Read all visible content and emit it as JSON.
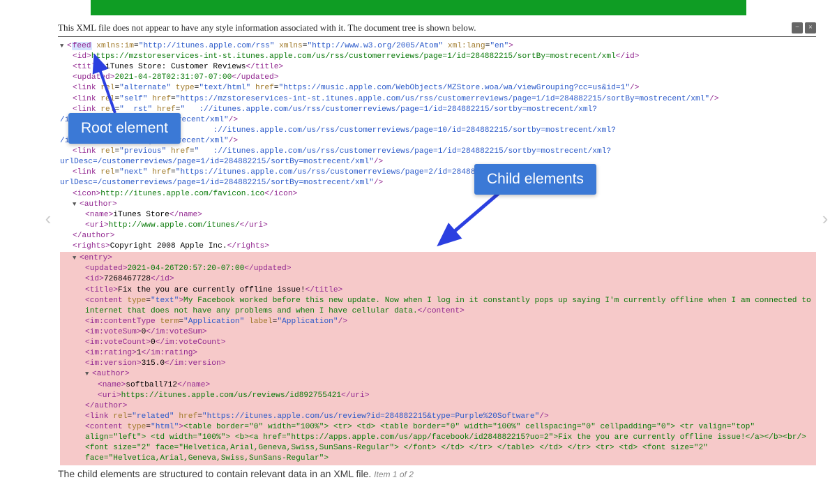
{
  "ui": {
    "info_text": "This XML file does not appear to have any style information associated with it. The document tree is shown below.",
    "minus_icon": "−",
    "close_icon": "×"
  },
  "callouts": {
    "root": "Root element",
    "child": "Child elements"
  },
  "caption": {
    "text": "The child elements are structured to contain relevant data in an XML file.",
    "item": "Item 1 of 2"
  },
  "xml": {
    "feed_open": {
      "tag": "feed",
      "attrs": "xmlns:im=\"http://itunes.apple.com/rss\" xmlns=\"http://www.w3.org/2005/Atom\" xml:lang=\"en\""
    },
    "id_url": "https://mzstoreservices-int-st.itunes.apple.com/us/rss/customerreviews/page=1/id=284882215/sortBy=mostrecent/xml",
    "title": "iTunes Store: Customer Reviews",
    "updated": "2021-04-28T02:31:07-07:00",
    "link_alt": {
      "rel": "alternate",
      "type": "text/html",
      "href": "https://music.apple.com/WebObjects/MZStore.woa/wa/viewGrouping?cc=us&id=1"
    },
    "link_self": {
      "rel": "self",
      "href": "https://mzstoreservices-int-st.itunes.apple.com/us/rss/customerreviews/page=1/id=284882215/sortBy=mostrecent/xml"
    },
    "link_first": {
      "rel": "first",
      "href_a": "://itunes.apple.com/us/rss/customerreviews/page=1/id=284882215/sortby=mostrecent/xml?",
      "href_b": "/id=284882215/sortBy=mostrecent/xml"
    },
    "link_last": {
      "href_a": "://itunes.apple.com/us/rss/customerreviews/page=10/id=284882215/sortby=mostrecent/xml?",
      "href_b": "/id=284882215/sortBy=mostrecent/xml"
    },
    "link_prev": {
      "rel": "previous",
      "href_line": "://itunes.apple.com/us/rss/customerreviews/page=1/id=284882215/sortby=mostrecent/xml?",
      "cont": "urlDesc=/customerreviews/page=1/id=284882215/sortBy=mostrecent/xml"
    },
    "link_next": {
      "rel": "next",
      "href_line": "https://itunes.apple.com/us/rss/customerreviews/page=2/id=284882215/sortby=m",
      "cont": "urlDesc=/customerreviews/page=1/id=284882215/sortBy=mostrecent/xml"
    },
    "icon": "http://itunes.apple.com/favicon.ico",
    "author_name": "iTunes Store",
    "author_uri": "http://www.apple.com/itunes/",
    "rights": "Copyright 2008 Apple Inc.",
    "entry": {
      "updated": "2021-04-26T20:57:20-07:00",
      "id": "7268467728",
      "title": "Fix the you are currently offline issue!",
      "content_text": "My Facebook worked before this new update. Now when I log in it constantly pops up saying I'm currently offline when I am connected to internet that does not have any problems and when I have cellular data.",
      "contentType": {
        "term": "Application",
        "label": "Application"
      },
      "voteSum": "0",
      "voteCount": "0",
      "rating": "1",
      "version": "315.0",
      "author_name": "softball712",
      "author_uri": "https://itunes.apple.com/us/reviews/id892755421",
      "link_related": "https://itunes.apple.com/us/review?id=284882215&type=Purple%20Software",
      "html_content": "<table border=\"0\" width=\"100%\"> <tr> <td> <table border=\"0\" width=\"100%\" cellspacing=\"0\" cellpadding=\"0\"> <tr valign=\"top\" align=\"left\"> <td width=\"100%\"> <b><a href=\"https://apps.apple.com/us/app/facebook/id284882215?uo=2\">Fix the you are currently offline issue!</a></b><br/> <font size=\"2\" face=\"Helvetica,Arial,Geneva,Swiss,SunSans-Regular\"> </font> </td> </tr> </table> </td> </tr> <tr> <td> <font size=\"2\" face=\"Helvetica,Arial,Geneva,Swiss,SunSans-Regular\">"
    }
  }
}
